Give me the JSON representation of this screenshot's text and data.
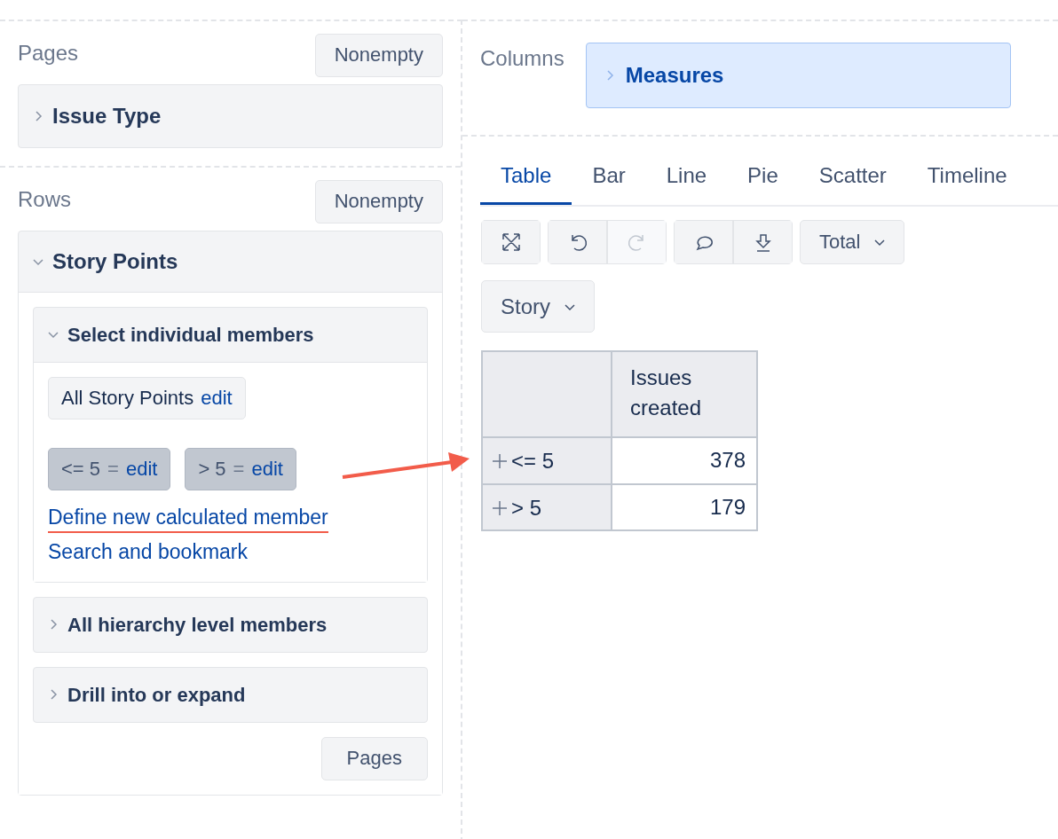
{
  "pages": {
    "title": "Pages",
    "button": "Nonempty",
    "items": [
      {
        "label": "Issue Type",
        "expanded": false
      }
    ]
  },
  "rows": {
    "title": "Rows",
    "button": "Nonempty",
    "dimension": {
      "label": "Story Points",
      "expanded": true,
      "sections": [
        {
          "label": "Select individual members",
          "expanded": true,
          "members": [
            {
              "kind": "all",
              "label": "All Story Points",
              "action": "edit"
            },
            {
              "kind": "calculated",
              "label": "<= 5",
              "operator": "=",
              "action": "edit"
            },
            {
              "kind": "calculated",
              "label": "> 5",
              "operator": "=",
              "action": "edit"
            }
          ],
          "links": [
            {
              "label": "Define new calculated member",
              "annotated": true
            },
            {
              "label": "Search and bookmark",
              "annotated": false
            }
          ]
        },
        {
          "label": "All hierarchy level members",
          "expanded": false
        },
        {
          "label": "Drill into or expand",
          "expanded": false
        }
      ],
      "footer_button": "Pages"
    }
  },
  "columns": {
    "title": "Columns",
    "items": [
      {
        "label": "Measures",
        "expanded": false
      }
    ]
  },
  "tabs": [
    {
      "label": "Table",
      "selected": true
    },
    {
      "label": "Bar",
      "selected": false
    },
    {
      "label": "Line",
      "selected": false
    },
    {
      "label": "Pie",
      "selected": false
    },
    {
      "label": "Scatter",
      "selected": false
    },
    {
      "label": "Timeline",
      "selected": false
    }
  ],
  "toolbar": {
    "groups": [
      [
        {
          "disabled": false
        }
      ],
      [
        {
          "disabled": false
        },
        {
          "disabled": true
        }
      ],
      [
        {
          "disabled": false
        },
        {
          "disabled": false
        }
      ]
    ],
    "dropdown": "Total"
  },
  "dimension_dropdown": "Story",
  "table": {
    "columns": [
      "Issues created"
    ],
    "rows": [
      {
        "label": "<= 5",
        "value": "378"
      },
      {
        "label": "> 5",
        "value": "179"
      }
    ]
  }
}
